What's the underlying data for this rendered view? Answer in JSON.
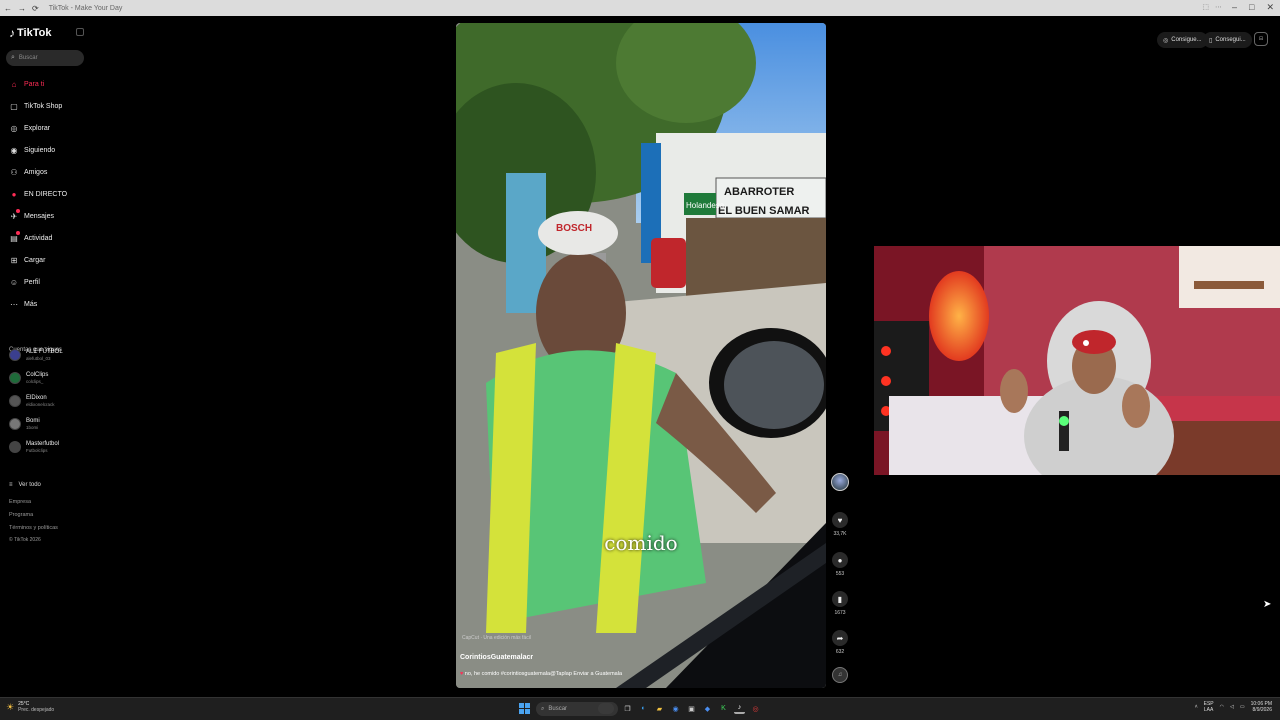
{
  "browser": {
    "tab_title": "TikTok - Make Your Day",
    "nav_back": "←",
    "nav_forward": "→",
    "nav_reload": "⟳",
    "win_min": "–",
    "win_max": "□",
    "win_close": "✕"
  },
  "sidebar": {
    "logo_text": "TikTok",
    "search_placeholder": "Buscar",
    "nav": [
      {
        "label": "Para ti",
        "icon": "home-icon"
      },
      {
        "label": "TikTok Shop",
        "icon": "shop-bag-icon"
      },
      {
        "label": "Explorar",
        "icon": "compass-icon"
      },
      {
        "label": "Siguiendo",
        "icon": "following-icon"
      },
      {
        "label": "Amigos",
        "icon": "friends-icon"
      },
      {
        "label": "EN DIRECTO",
        "icon": "live-icon"
      },
      {
        "label": "Mensajes",
        "icon": "messages-icon"
      },
      {
        "label": "Actividad",
        "icon": "activity-icon"
      },
      {
        "label": "Cargar",
        "icon": "upload-icon"
      },
      {
        "label": "Perfil",
        "icon": "profile-icon"
      },
      {
        "label": "Más",
        "icon": "more-icon"
      }
    ],
    "following_title": "Cuentas que sigues",
    "accounts": [
      {
        "name": "ALE FÚTBOL",
        "handle": "alefutbol_03"
      },
      {
        "name": "ColClips",
        "handle": "colclips_"
      },
      {
        "name": "ElDixon",
        "handle": "eldixonelcrack"
      },
      {
        "name": "Bomi",
        "handle": "1bomi"
      },
      {
        "name": "Masterfutbol",
        "handle": "Futbolclips"
      }
    ],
    "see_all": "Ver todo",
    "footer": [
      "Empresa",
      "Programa",
      "Términos y políticas",
      "© TikTok 2026"
    ]
  },
  "top_buttons": {
    "get_coins": "Consigue...",
    "get_app": "Consegui..."
  },
  "video": {
    "subtitle_word": "comido",
    "capcut_label": "CapCut · Una edición más fácil",
    "author": "CorintiosGuatemalacr",
    "description": "no, he comido #corintiosguatemala@Taplap Enviar a Guatemala",
    "sign_text_1": "ABARROTER",
    "sign_text_2": "EL BUEN SAMAR",
    "sign_text_3": "Holandesa",
    "cap_text": "BOSCH"
  },
  "actions": {
    "likes": "33,7K",
    "comments": "553",
    "saves": "1673",
    "shares": "632"
  },
  "taskbar": {
    "temp": "25°C",
    "weather": "Prec. despejado",
    "search": "Buscar",
    "lang_1": "ESP",
    "lang_2": "LAA",
    "time": "10:06 PM",
    "date": "8/9/2026"
  },
  "colors": {
    "accent": "#fe2c55",
    "background": "#000000",
    "taskbar": "#1f1f1f"
  }
}
